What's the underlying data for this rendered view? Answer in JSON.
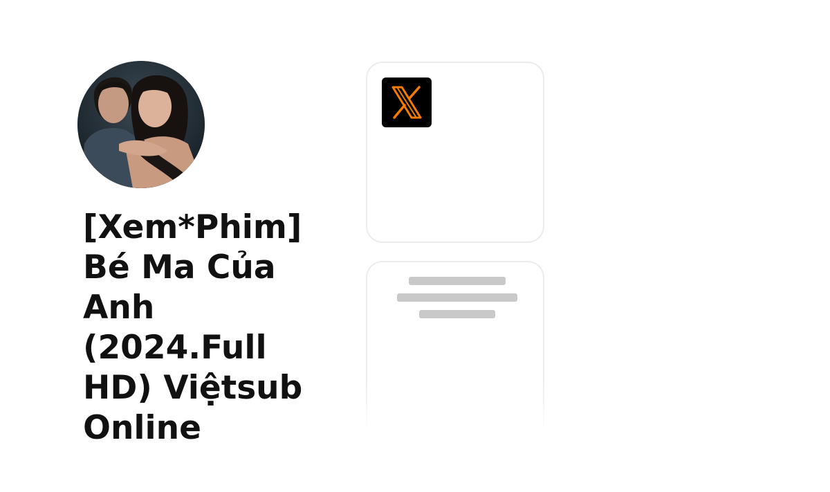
{
  "profile": {
    "avatar_icon": "profile-avatar-photo",
    "title": "[Xem*Phim] Bé Ma Của Anh (2024.Full HD) Việtsub Online"
  },
  "links": [
    {
      "icon": "x-logo-icon",
      "accent": "#f57c00"
    },
    {
      "state": "loading"
    }
  ]
}
